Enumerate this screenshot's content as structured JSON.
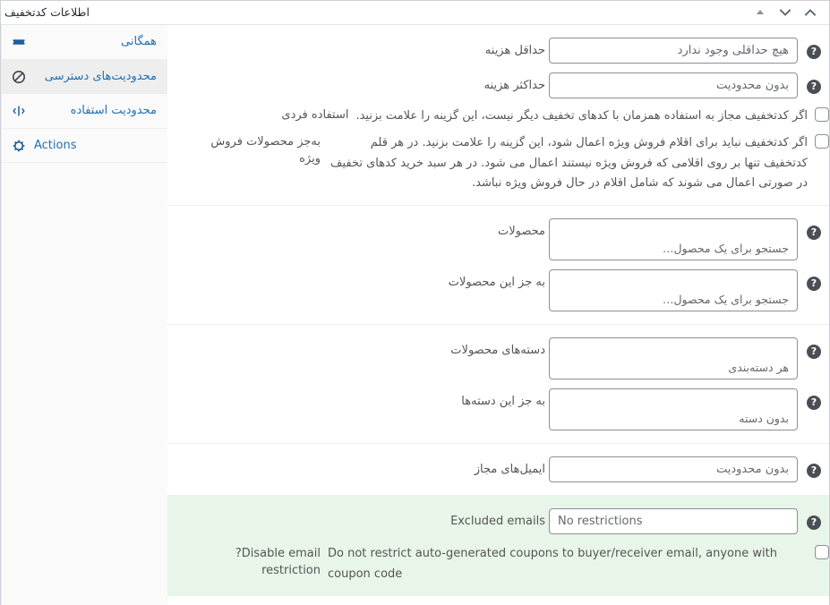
{
  "metabox": {
    "title": "اطلاعات کدتخفیف",
    "handle_buttons": [
      {
        "name": "order-higher",
        "icon": "triangle-up-icon",
        "label": "بالا بردن"
      },
      {
        "name": "move-down",
        "icon": "chevron-down-icon",
        "label": "پایین"
      },
      {
        "name": "move-up",
        "icon": "chevron-up-icon",
        "label": "بالا"
      }
    ]
  },
  "tabs": [
    {
      "id": "general",
      "label": "همگانی",
      "icon": "ticket-icon",
      "active": false,
      "ltr": false
    },
    {
      "id": "usage-restriction",
      "label": "محدودیت‌های دسترسی",
      "icon": "block-icon",
      "active": true,
      "ltr": false
    },
    {
      "id": "usage-limit",
      "label": "محدودیت استفاده",
      "icon": "usage-limit-icon",
      "active": false,
      "ltr": false
    },
    {
      "id": "actions",
      "label": "Actions",
      "icon": "gear-icon",
      "active": false,
      "ltr": true
    }
  ],
  "groups": [
    {
      "id": "amount-limits",
      "highlight": false,
      "fields": [
        {
          "type": "text",
          "name": "minimum-amount",
          "label": "حداقل هزینه",
          "value": "",
          "placeholder": "هیچ حداقلی وجود ندارد",
          "ltr": false,
          "help": "?"
        },
        {
          "type": "text",
          "name": "maximum-amount",
          "label": "حداکثر هزینه",
          "value": "",
          "placeholder": "بدون محدودیت",
          "ltr": false,
          "help": "?"
        },
        {
          "type": "checkbox",
          "name": "individual-use-only",
          "label": "استفاده فردی",
          "checked": false,
          "description": "اگر کدتخفیف مجاز به استفاده همزمان با کدهای تخفیف دیگر نیست، این گزینه را علامت بزنید.",
          "ltr": false
        },
        {
          "type": "checkbox",
          "name": "exclude-sale-items",
          "label": "به‌جز محصولات فروش ویژه",
          "checked": false,
          "description": "اگر کدتخفیف نباید برای اقلام فروش ویژه اعمال شود، این گزینه را علامت بزنید. در هر قلم کدتخفیف تنها بر روی اقلامی که فروش ویژه نیستند اعمال می شود. در هر سبد خرید کدهای تخفیف در صورتی اعمال می شوند که شامل اقلام در حال فروش ویژه نباشد.",
          "ltr": false
        }
      ]
    },
    {
      "id": "products",
      "highlight": false,
      "fields": [
        {
          "type": "select2",
          "name": "products",
          "label": "محصولات",
          "placeholder": "جستجو برای یک محصول…",
          "ltr": false,
          "help": "?"
        },
        {
          "type": "select2",
          "name": "exclude-products",
          "label": "به جز این محصولات",
          "placeholder": "جستجو برای یک محصول…",
          "ltr": false,
          "help": "?"
        }
      ]
    },
    {
      "id": "categories",
      "highlight": false,
      "fields": [
        {
          "type": "select2",
          "name": "product-categories",
          "label": "دسته‌های محصولات",
          "placeholder": "هر دسته‌بندی",
          "ltr": false,
          "help": "?"
        },
        {
          "type": "select2",
          "name": "exclude-product-categories",
          "label": "به جز این دسته‌ها",
          "placeholder": "بدون دسته",
          "ltr": false,
          "help": "?"
        }
      ]
    },
    {
      "id": "allowed-emails",
      "highlight": false,
      "fields": [
        {
          "type": "text",
          "name": "allowed-emails",
          "label": "ایمیل‌های مجاز",
          "value": "",
          "placeholder": "بدون محدودیت",
          "ltr": false,
          "help": "?"
        }
      ]
    },
    {
      "id": "excluded-emails",
      "highlight": true,
      "fields": [
        {
          "type": "text",
          "name": "excluded-emails",
          "label": "Excluded emails",
          "value": "",
          "placeholder": "No restrictions",
          "ltr": true,
          "help": "?"
        },
        {
          "type": "checkbox",
          "name": "disable-email-restriction",
          "label": "?Disable email restriction",
          "checked": false,
          "description": "Do not restrict auto-generated coupons to buyer/receiver email, anyone with coupon code",
          "ltr": true
        }
      ]
    }
  ],
  "colors": {
    "tab_link": "#2271b1",
    "tab_active_bg": "#eee",
    "highlight_bg": "#e8f5e9",
    "border": "#eee",
    "input_border": "#8c8f94",
    "help_bg": "#4a4f55"
  }
}
